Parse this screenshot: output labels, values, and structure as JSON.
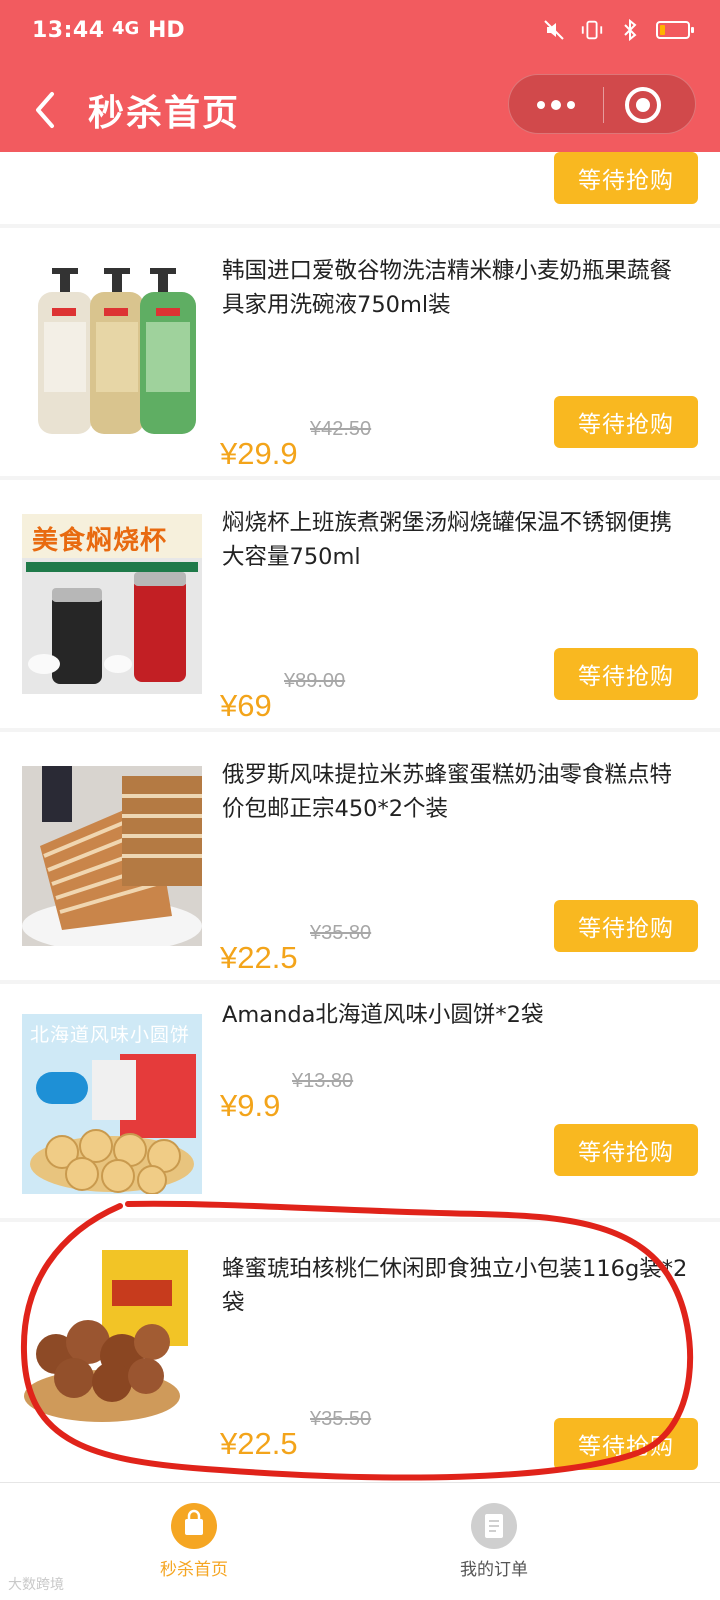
{
  "status": {
    "time": "13:44",
    "network": "4G",
    "hd": "HD"
  },
  "nav": {
    "title": "秒杀首页"
  },
  "colors": {
    "brand": "#f25b5f",
    "accent": "#f9b820",
    "price": "#f3a41a"
  },
  "products": [
    {
      "button": "等待抢购"
    },
    {
      "name": "韩国进口爱敬谷物洗洁精米糠小麦奶瓶果蔬餐具家用洗碗液750ml装",
      "price": "¥29.9",
      "original": "¥42.50",
      "button": "等待抢购"
    },
    {
      "name": "焖烧杯上班族煮粥堡汤焖烧罐保温不锈钢便携大容量750ml",
      "price": "¥69",
      "original": "¥89.00",
      "button": "等待抢购",
      "banner": "美食焖烧杯"
    },
    {
      "name": "俄罗斯风味提拉米苏蜂蜜蛋糕奶油零食糕点特价包邮正宗450*2个装",
      "price": "¥22.5",
      "original": "¥35.80",
      "button": "等待抢购"
    },
    {
      "name": "Amanda北海道风味小圆饼*2袋",
      "price": "¥9.9",
      "original": "¥13.80",
      "button": "等待抢购",
      "banner": "北海道风味小圆饼"
    },
    {
      "name": "蜂蜜琥珀核桃仁休闲即食独立小包装116g装*2袋",
      "price": "¥22.5",
      "original": "¥35.50",
      "button": "等待抢购"
    }
  ],
  "tabbar": {
    "items": [
      {
        "label": "秒杀首页",
        "active": true
      },
      {
        "label": "我的订单",
        "active": false
      }
    ]
  },
  "watermark": "大数跨境"
}
